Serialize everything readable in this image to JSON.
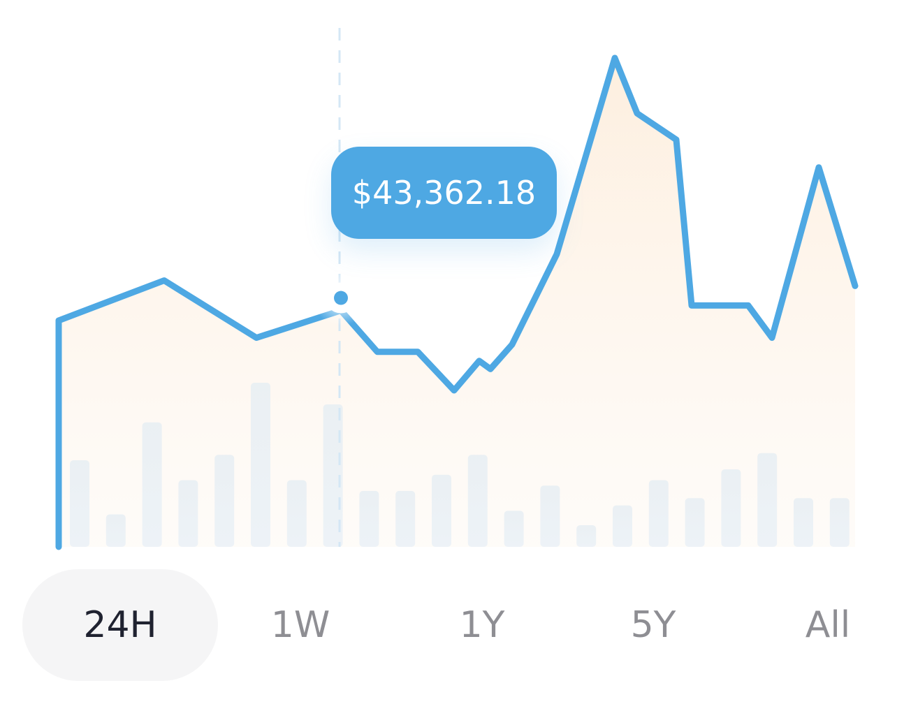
{
  "chart_data": {
    "type": "line",
    "series": [
      {
        "values": [
          42.2,
          51,
          38.4,
          44.4,
          35.3,
          35.3,
          26.8,
          33.3,
          31.5,
          36.9,
          56.8,
          100,
          87.8,
          82,
          45.5,
          45.5,
          38.4,
          75.9,
          49.8
        ]
      }
    ],
    "volume": [
      48,
      18,
      69,
      37,
      51,
      91,
      37,
      79,
      31,
      31,
      40,
      51,
      20,
      34,
      12,
      23,
      37,
      27,
      43,
      52,
      27,
      27
    ],
    "highlight": {
      "index": 3,
      "value": 44.4,
      "label": "$43,362.18"
    },
    "colors": {
      "line": "#4ea8e3",
      "area_fill": "#fdf0e2",
      "bars": "#e8f0f6",
      "tooltip_bg": "#4ea8e3",
      "tooltip_text": "#ffffff",
      "active_tab_bg": "#f5f5f6",
      "active_tab_text": "#1f2230",
      "inactive_tab_text": "#8e8e93"
    }
  },
  "time_range_tabs": [
    {
      "label": "24H",
      "active": true
    },
    {
      "label": "1W",
      "active": false
    },
    {
      "label": "1Y",
      "active": false
    },
    {
      "label": "5Y",
      "active": false
    },
    {
      "label": "All",
      "active": false
    }
  ]
}
